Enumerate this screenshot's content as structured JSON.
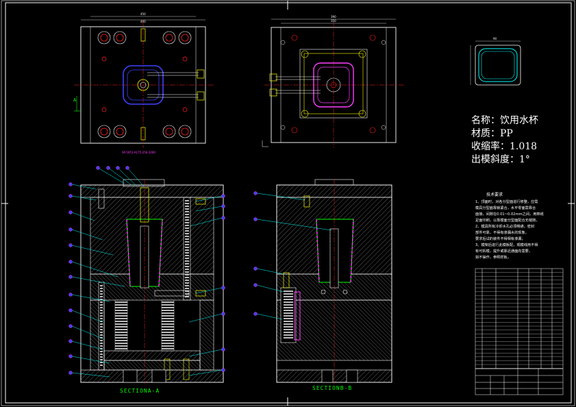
{
  "spec": {
    "name": "名称：饮用水杯",
    "material": "材质：PP",
    "shrinkage": "收缩率：1.018",
    "draft": "出模斜度：1°"
  },
  "sections": {
    "a": "SECTIONA-A",
    "b": "SECTIONB-B"
  },
  "mark": {
    "a": "A"
  },
  "tech_notes": {
    "title": "技术要求",
    "lines": [
      "1、顶面时，对各分型面进行修整，应需",
      "模具分型面靠锁紧合，水平零面需靠合",
      "面接，间隙在0.01~0.02mm之间，用棉纸",
      "足面印刷，以靠模面分型面配合无缝隙。",
      "2、模具所有冷却水孔必须畅通，密封",
      "部件可靠，不得有渗漏水的现象，",
      "要求后试的装件不得相有渗漏；",
      "3、模架后进行此模板配，观模线用不得",
      "有可拆模，提升或靠近通面向需要，",
      "如不操作，参照样板。"
    ]
  },
  "colors": {
    "frame": "#ffffff",
    "plate": "#ffffff",
    "cyan": "#00ffff",
    "green": "#00ff00",
    "red": "#ff2020",
    "magenta": "#ff40ff",
    "yellow": "#ffff00",
    "blue": "#4040ff"
  }
}
